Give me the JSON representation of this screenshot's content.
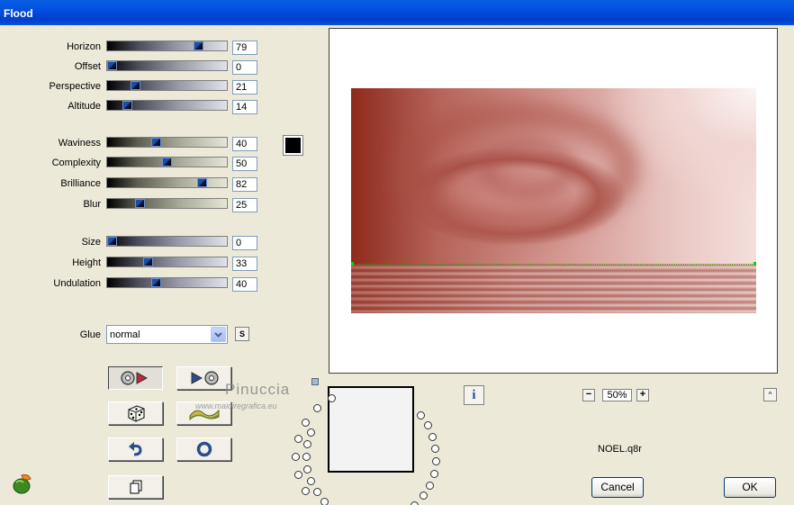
{
  "window": {
    "title": "Flood"
  },
  "sliders": [
    {
      "label": "Horizon",
      "value": "79",
      "level": 0.79,
      "scheme": "a"
    },
    {
      "label": "Offset",
      "value": "0",
      "level": 0.0,
      "scheme": "a"
    },
    {
      "label": "Perspective",
      "value": "21",
      "level": 0.21,
      "scheme": "a"
    },
    {
      "label": "Altitude",
      "value": "14",
      "level": 0.14,
      "scheme": "a"
    },
    {
      "label": "Waviness",
      "value": "40",
      "level": 0.4,
      "scheme": "b"
    },
    {
      "label": "Complexity",
      "value": "50",
      "level": 0.5,
      "scheme": "b"
    },
    {
      "label": "Brilliance",
      "value": "82",
      "level": 0.82,
      "scheme": "b"
    },
    {
      "label": "Blur",
      "value": "25",
      "level": 0.25,
      "scheme": "b"
    },
    {
      "label": "Size",
      "value": "0",
      "level": 0.0,
      "scheme": "a"
    },
    {
      "label": "Height",
      "value": "33",
      "level": 0.33,
      "scheme": "a"
    },
    {
      "label": "Undulation",
      "value": "40",
      "level": 0.4,
      "scheme": "a"
    }
  ],
  "color_swatch": {
    "color": "#000000"
  },
  "glue": {
    "label": "Glue",
    "value": "normal",
    "side_button": "S"
  },
  "toolbar_buttons": [
    {
      "name": "apply-to-image-button",
      "icon": "disc-play-icon",
      "pressed": true
    },
    {
      "name": "play-disc-button",
      "icon": "play-disc-icon",
      "pressed": false
    },
    {
      "name": "random-button",
      "icon": "dice-icon",
      "pressed": false
    },
    {
      "name": "wave-button",
      "icon": "wave-icon",
      "pressed": false
    },
    {
      "name": "reset-button",
      "icon": "undo-arrow-icon",
      "pressed": false
    },
    {
      "name": "circle-button",
      "icon": "circle-icon",
      "pressed": false
    },
    {
      "name": "copy-button",
      "icon": "copy-icon",
      "pressed": false
    }
  ],
  "watermark": {
    "line1": "Pinuccia",
    "line2": "www.maidiregrafica.eu"
  },
  "preview": {
    "info_label": "i",
    "zoom": "50%",
    "zoom_minus": "−",
    "zoom_plus": "+",
    "up_label": "^",
    "file_name": "NOEL.q8r"
  },
  "buttons": {
    "cancel": "Cancel",
    "ok": "OK"
  }
}
